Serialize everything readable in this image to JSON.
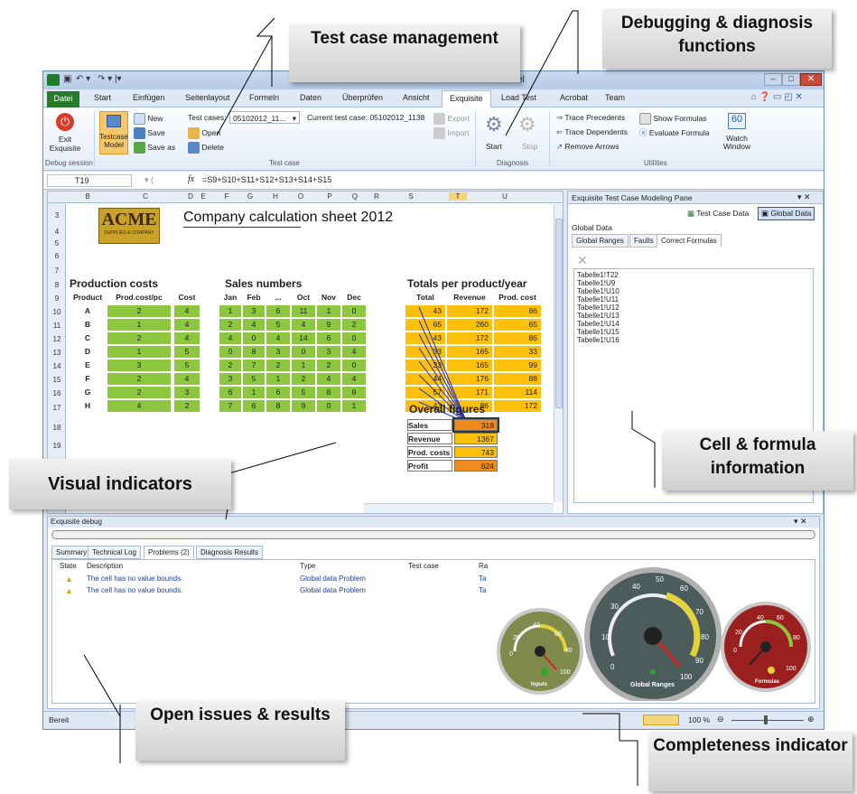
{
  "window": {
    "title": "cel",
    "menu": [
      "Datei",
      "Start",
      "Einfügen",
      "Seitenlayout",
      "Formeln",
      "Daten",
      "Überprüfen",
      "Ansicht",
      "Exquisite",
      "Load Test",
      "Acrobat",
      "Team"
    ],
    "active_tab": "Exquisite"
  },
  "ribbon": {
    "exit_label": "Exit Exquisite",
    "debug_group": "Debug session",
    "testcase_model": "Testcase Model",
    "new": "New",
    "save": "Save",
    "save_as": "Save as",
    "open": "Open",
    "delete": "Delete",
    "test_cases_label": "Test cases:",
    "test_cases_value": "05102012_11...",
    "current_test_case": "Current test case: 05102012_1138",
    "export": "Export",
    "import": "Import",
    "test_case_group": "Test case",
    "start": "Start",
    "stop": "Stop",
    "diagnosis_group": "Diagnosis",
    "trace_precedents": "Trace Precedents",
    "trace_dependents": "Trace Dependents",
    "remove_arrows": "Remove Arrows",
    "show_formulas": "Show Formulas",
    "evaluate_formula": "Evaluate Formula",
    "watch_window": "Watch Window",
    "utilities_group": "Utilities"
  },
  "formula_bar": {
    "name_box": "T19",
    "fx": "fx",
    "formula": "=S9+S10+S11+S12+S13+S14+S15"
  },
  "sheet": {
    "columns": [
      "B",
      "C",
      "D",
      "E",
      "F",
      "G",
      "H",
      "O",
      "P",
      "Q",
      "R",
      "S",
      "T",
      "U"
    ],
    "rows": [
      "3",
      "4",
      "5",
      "6",
      "7",
      "8",
      "9",
      "10",
      "11",
      "12",
      "13",
      "14",
      "15",
      "16",
      "17",
      "18",
      "19",
      "20",
      "21"
    ],
    "logo": "ACME",
    "logo_sub": "SUPPLIES & COMPANY",
    "title": "Company calculation sheet 2012",
    "prod_costs_title": "Production costs",
    "prod_headers": [
      "Product",
      "Prod.cost/pc",
      "Cost"
    ],
    "sales_title": "Sales numbers",
    "sales_headers": [
      "Jan",
      "Feb",
      "...",
      "Oct",
      "Nov",
      "Dec"
    ],
    "totals_title": "Totals per product/year",
    "totals_headers": [
      "Total Sales",
      "Revenue",
      "Prod. cost"
    ],
    "products": [
      {
        "p": "A",
        "pc": "2",
        "c": "4",
        "s": [
          "1",
          "3",
          "6",
          "11",
          "1",
          "0"
        ],
        "t": [
          "43",
          "172",
          "86"
        ]
      },
      {
        "p": "B",
        "pc": "1",
        "c": "4",
        "s": [
          "2",
          "4",
          "5",
          "4",
          "9",
          "2"
        ],
        "t": [
          "65",
          "260",
          "65"
        ]
      },
      {
        "p": "C",
        "pc": "2",
        "c": "4",
        "s": [
          "4",
          "0",
          "4",
          "14",
          "6",
          "0"
        ],
        "t": [
          "43",
          "172",
          "86"
        ]
      },
      {
        "p": "D",
        "pc": "1",
        "c": "5",
        "s": [
          "0",
          "8",
          "3",
          "0",
          "3",
          "4"
        ],
        "t": [
          "33",
          "165",
          "33"
        ]
      },
      {
        "p": "E",
        "pc": "3",
        "c": "5",
        "s": [
          "2",
          "7",
          "2",
          "1",
          "2",
          "0"
        ],
        "t": [
          "33",
          "165",
          "99"
        ]
      },
      {
        "p": "F",
        "pc": "2",
        "c": "4",
        "s": [
          "3",
          "5",
          "1",
          "2",
          "4",
          "4"
        ],
        "t": [
          "44",
          "176",
          "88"
        ]
      },
      {
        "p": "G",
        "pc": "2",
        "c": "3",
        "s": [
          "6",
          "1",
          "6",
          "5",
          "8",
          "8"
        ],
        "t": [
          "57",
          "171",
          "114"
        ]
      },
      {
        "p": "H",
        "pc": "4",
        "c": "2",
        "s": [
          "7",
          "6",
          "8",
          "9",
          "0",
          "1"
        ],
        "t": [
          "43",
          "86",
          "172"
        ]
      }
    ],
    "overall_title": "Overall figures",
    "overall": [
      {
        "label": "Sales",
        "value": "318"
      },
      {
        "label": "Revenue",
        "value": "1367"
      },
      {
        "label": "Prod. costs",
        "value": "743"
      },
      {
        "label": "Profit",
        "value": "624"
      }
    ]
  },
  "pane": {
    "title": "Exquisite Test Case Modeling Pane",
    "btn_test_case_data": "Test Case Data",
    "btn_global_data": "Global Data",
    "section": "Global Data",
    "tabs": [
      "Global Ranges",
      "Faults",
      "Correct Formulas"
    ],
    "formulas": [
      "Tabelle1!T22",
      "Tabelle1!U9",
      "Tabelle1!U10",
      "Tabelle1!U11",
      "Tabelle1!U12",
      "Tabelle1!U13",
      "Tabelle1!U14",
      "Tabelle1!U15",
      "Tabelle1!U16"
    ]
  },
  "debug": {
    "title": "Exquisite debug",
    "tabs": [
      "Summary",
      "Technical Log",
      "Problems (2)",
      "Diagnosis Results"
    ],
    "columns": [
      "State",
      "Description",
      "Type",
      "Test case",
      "Ra"
    ],
    "rows": [
      {
        "desc": "The cell has no value bounds.",
        "type": "Global data Problem",
        "ra": "Ta"
      },
      {
        "desc": "The cell has no value bounds.",
        "type": "Global data Problem",
        "ra": "Ta"
      }
    ],
    "gauges": [
      {
        "label": "Inputs",
        "color": "#7e8b4c",
        "ticks": [
          "0",
          "20",
          "40",
          "60",
          "80",
          "100"
        ]
      },
      {
        "label": "Global Ranges",
        "color": "#4b5c5b",
        "ticks": [
          "0",
          "10",
          "20",
          "30",
          "40",
          "50",
          "60",
          "70",
          "80",
          "90",
          "100"
        ]
      },
      {
        "label": "Formulas",
        "color": "#9a2020",
        "ticks": [
          "0",
          "20",
          "40",
          "60",
          "80",
          "100"
        ]
      }
    ]
  },
  "status": {
    "text": "Bereit",
    "zoom": "100 %"
  },
  "callouts": {
    "test_case": "Test case management",
    "debugging": "Debugging & diagnosis functions",
    "visual": "Visual indicators",
    "cell_formula": "Cell & formula information",
    "open_issues": "Open issues & results",
    "completeness": "Completeness indicator"
  },
  "colors": {
    "green": "#8dc63f",
    "orange": "#fcc00a",
    "accent": "#2a7a2e"
  }
}
